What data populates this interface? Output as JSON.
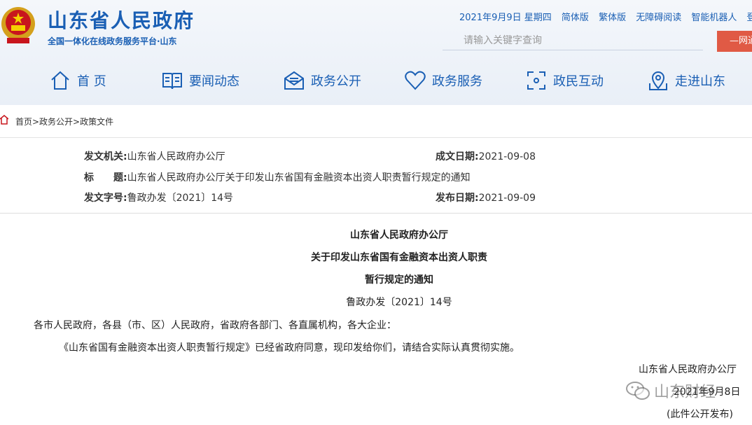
{
  "header": {
    "site_title": "山东省人民政府",
    "site_subtitle": "全国一体化在线政务服务平台·山东",
    "date": "2021年9月9日 星期四",
    "links": [
      "简体版",
      "繁体版",
      "无障碍阅读",
      "智能机器人",
      "登录"
    ],
    "search_placeholder": "请输入关键字查询",
    "search_button": "—网通"
  },
  "nav": [
    "首 页",
    "要闻动态",
    "政务公开",
    "政务服务",
    "政民互动",
    "走进山东"
  ],
  "breadcrumb": "首页>政务公开>政策文件",
  "meta": {
    "issuer_label": "发文机关:",
    "issuer": "山东省人民政府办公厅",
    "date_label": "成文日期:",
    "date": "2021-09-08",
    "title_label": "标　　题:",
    "title": "山东省人民政府办公厅关于印发山东省国有金融资本出资人职责暂行规定的通知",
    "number_label": "发文字号:",
    "number": "鲁政办发〔2021〕14号",
    "publish_label": "发布日期:",
    "publish": "2021-09-09"
  },
  "document": {
    "heading1": "山东省人民政府办公厅",
    "heading2": "关于印发山东省国有金融资本出资人职责",
    "heading3": "暂行规定的通知",
    "doc_number": "鲁政办发〔2021〕14号",
    "addressee": "各市人民政府，各县（市、区）人民政府，省政府各部门、各直属机构，各大企业：",
    "body": "《山东省国有金融资本出资人职责暂行规定》已经省政府同意，现印发给你们，请结合实际认真贯彻实施。",
    "signature": "山东省人民政府办公厅",
    "sign_date": "2021年9月8日",
    "note": "(此件公开发布)"
  },
  "watermark": "山东财经"
}
